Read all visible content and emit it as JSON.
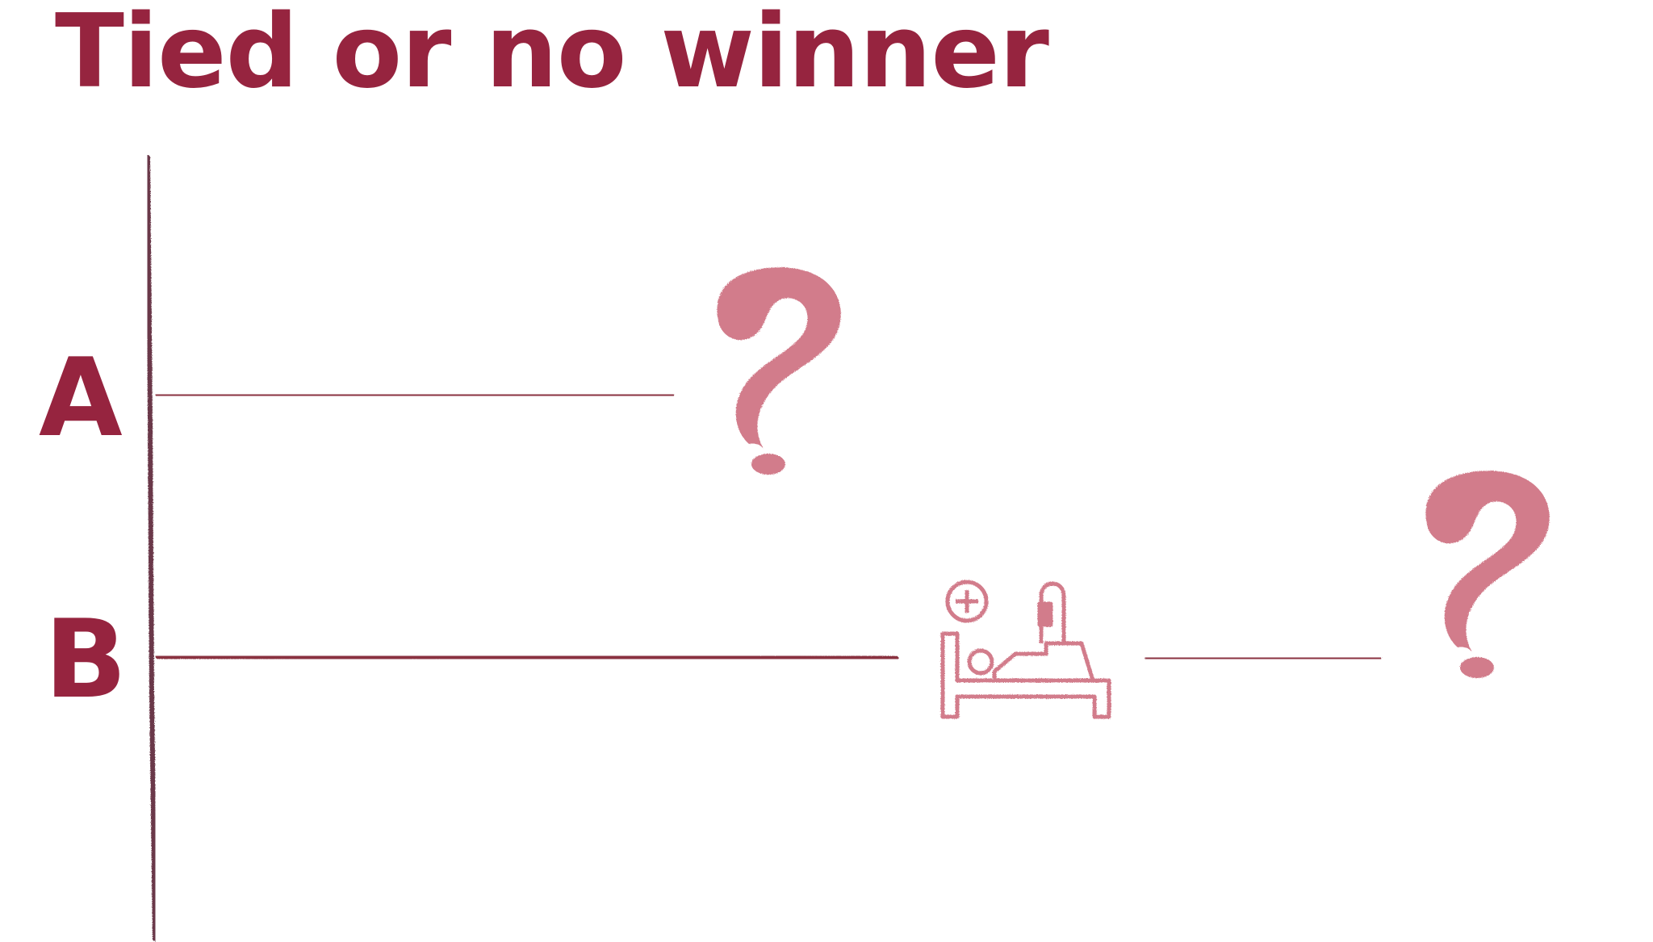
{
  "title": "Tied or no winner",
  "rows": [
    {
      "label": "A",
      "outcome": "question-mark-icon"
    },
    {
      "label": "B",
      "interruption": "hospital-bed-icon",
      "outcome": "question-mark-icon"
    }
  ],
  "colors": {
    "title": "#96243f",
    "axis": "#6a3848",
    "line": "#8a3040",
    "icon": "#d27c8b"
  }
}
